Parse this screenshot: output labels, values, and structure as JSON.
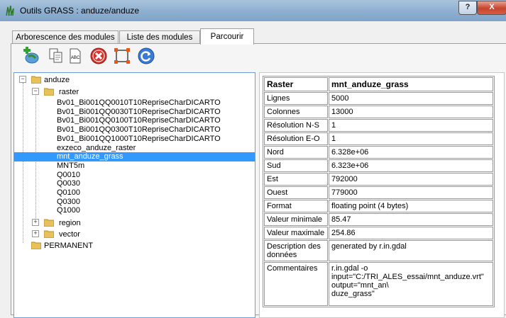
{
  "window": {
    "title": "Outils GRASS : anduze/anduze",
    "help_label": "?",
    "close_label": "X"
  },
  "tabs": [
    {
      "label": "Arborescence des modules"
    },
    {
      "label": "Liste des modules"
    },
    {
      "label": "Parcourir"
    }
  ],
  "toolbar": [
    {
      "icon": "add-layer-icon"
    },
    {
      "icon": "copy-icon"
    },
    {
      "icon": "rename-icon"
    },
    {
      "icon": "delete-icon"
    },
    {
      "icon": "set-region-icon"
    },
    {
      "icon": "refresh-icon"
    }
  ],
  "tree": {
    "location": "anduze",
    "mapsets": {
      "raster": "raster",
      "region": "region",
      "vector": "vector",
      "permanent": "PERMANENT"
    },
    "rasters": [
      "Bv01_Bi001QQ0010T10RepriseCharDICARTO",
      "Bv01_Bi001QQ0030T10RepriseCharDICARTO",
      "Bv01_Bi001QQ0100T10RepriseCharDICARTO",
      "Bv01_Bi001QQ0300T10RepriseCharDICARTO",
      "Bv01_Bi001QQ1000T10RepriseCharDICARTO",
      "exzeco_anduze_raster",
      "mnt_anduze_grass",
      "MNT5m",
      "Q0010",
      "Q0030",
      "Q0100",
      "Q0300",
      "Q1000"
    ],
    "selected_index": 6
  },
  "info": {
    "header": {
      "key": "Raster",
      "value": "mnt_anduze_grass"
    },
    "rows": [
      {
        "key": "Lignes",
        "value": "5000"
      },
      {
        "key": "Colonnes",
        "value": "13000"
      },
      {
        "key": "Résolution N-S",
        "value": "1"
      },
      {
        "key": "Résolution E-O",
        "value": "1"
      },
      {
        "key": "Nord",
        "value": "6.328e+06"
      },
      {
        "key": "Sud",
        "value": "6.323e+06"
      },
      {
        "key": "Est",
        "value": "792000"
      },
      {
        "key": "Ouest",
        "value": "779000"
      },
      {
        "key": "Format",
        "value": "floating point (4 bytes)"
      },
      {
        "key": "Valeur minimale",
        "value": "85.47"
      },
      {
        "key": "Valeur maximale",
        "value": "254.86"
      },
      {
        "key": "Description des données",
        "value": "generated by r.in.gdal"
      },
      {
        "key": "Commentaires",
        "value": "r.in.gdal -o\ninput=\"C:/TRI_ALES_essai/mnt_anduze.vrt\"\noutput=\"mnt_an\\\nduze_grass\""
      }
    ]
  },
  "colors": {
    "selection": "#3399ff",
    "delete": "#d9332b",
    "refresh": "#3a7bd5"
  }
}
